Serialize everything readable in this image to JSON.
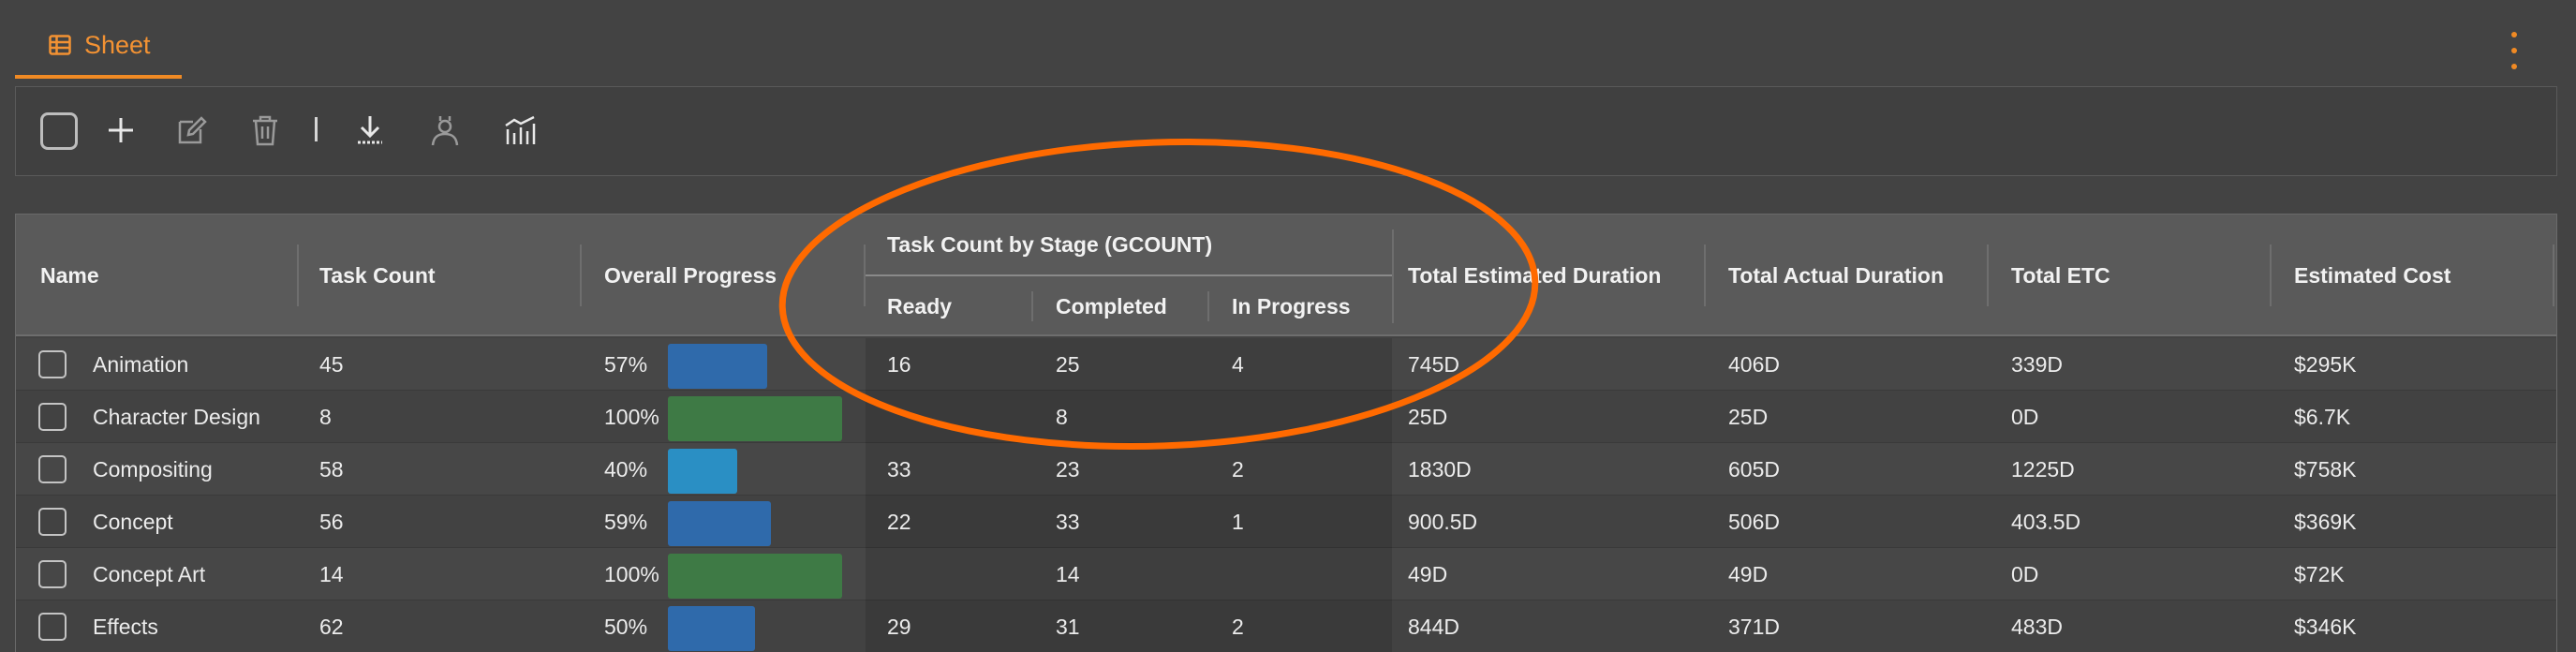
{
  "tabs": [
    {
      "label": "Sheet",
      "icon": "table-icon",
      "active": true
    }
  ],
  "accent_color": "#f08a24",
  "toolbar": {
    "items": [
      "select-all-checkbox",
      "plus-icon",
      "edit-icon",
      "trash-icon",
      "separator",
      "download-icon",
      "assign-user-icon",
      "chart-icon"
    ]
  },
  "table": {
    "headers": {
      "name": "Name",
      "task_count": "Task Count",
      "overall_progress": "Overall Progress",
      "group": "Task Count by Stage (GCOUNT)",
      "ready": "Ready",
      "completed": "Completed",
      "in_progress": "In Progress",
      "total_estimated_duration": "Total Estimated Duration",
      "total_actual_duration": "Total Actual Duration",
      "total_etc": "Total ETC",
      "estimated_cost": "Estimated Cost"
    },
    "rows": [
      {
        "name": "Animation",
        "task_count": "45",
        "progress_label": "57%",
        "progress": 0.57,
        "bar_color": "#2f6aab",
        "ready": "16",
        "completed": "25",
        "in_progress": "4",
        "ted": "745D",
        "tad": "406D",
        "etc": "339D",
        "cost": "$295K"
      },
      {
        "name": "Character Design",
        "task_count": "8",
        "progress_label": "100%",
        "progress": 1.0,
        "bar_color": "#3e7a45",
        "ready": "",
        "completed": "8",
        "in_progress": "",
        "ted": "25D",
        "tad": "25D",
        "etc": "0D",
        "cost": "$6.7K"
      },
      {
        "name": "Compositing",
        "task_count": "58",
        "progress_label": "40%",
        "progress": 0.4,
        "bar_color": "#2a8fc4",
        "ready": "33",
        "completed": "23",
        "in_progress": "2",
        "ted": "1830D",
        "tad": "605D",
        "etc": "1225D",
        "cost": "$758K"
      },
      {
        "name": "Concept",
        "task_count": "56",
        "progress_label": "59%",
        "progress": 0.59,
        "bar_color": "#2f6aab",
        "ready": "22",
        "completed": "33",
        "in_progress": "1",
        "ted": "900.5D",
        "tad": "506D",
        "etc": "403.5D",
        "cost": "$369K"
      },
      {
        "name": "Concept Art",
        "task_count": "14",
        "progress_label": "100%",
        "progress": 1.0,
        "bar_color": "#3e7a45",
        "ready": "",
        "completed": "14",
        "in_progress": "",
        "ted": "49D",
        "tad": "49D",
        "etc": "0D",
        "cost": "$72K"
      },
      {
        "name": "Effects",
        "task_count": "62",
        "progress_label": "50%",
        "progress": 0.5,
        "bar_color": "#2f6aab",
        "ready": "29",
        "completed": "31",
        "in_progress": "2",
        "ted": "844D",
        "tad": "371D",
        "etc": "483D",
        "cost": "$346K"
      }
    ]
  }
}
